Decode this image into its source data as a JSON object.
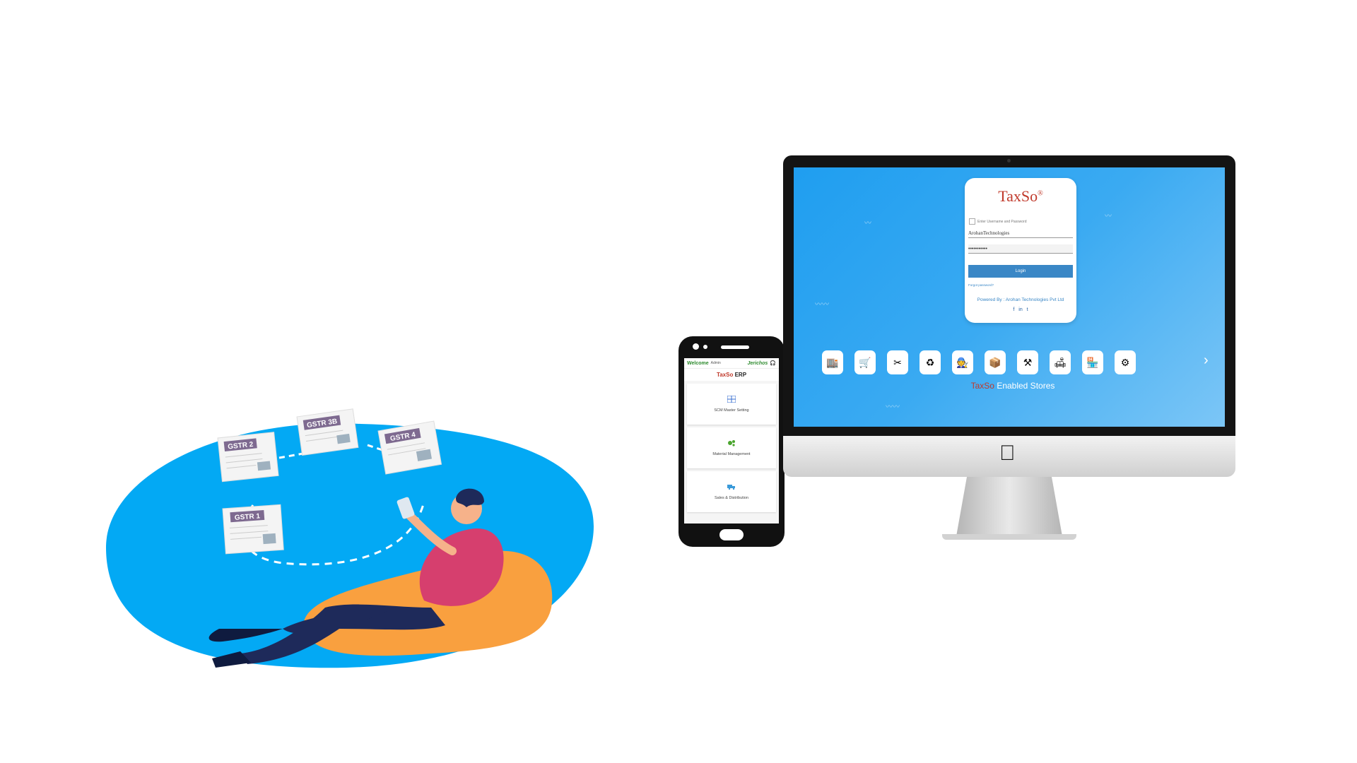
{
  "illustration": {
    "forms": [
      "GSTR 2",
      "GSTR 3B",
      "GSTR 4",
      "GSTR 1"
    ]
  },
  "phone": {
    "welcome": "Welcome",
    "admin": "Admin",
    "brand": "Jerichos",
    "title_brand": "TaxSo",
    "title_suffix": "ERP",
    "cards": [
      {
        "label": "SCM Master Setting",
        "icon": "grid-icon"
      },
      {
        "label": "Material Management",
        "icon": "gears-icon"
      },
      {
        "label": "Sales & Distribution",
        "icon": "truck-icon"
      }
    ]
  },
  "login": {
    "logo": "TaxSo",
    "logo_mark": "®",
    "prompt": "Enter Username and Password",
    "username": "ArohanTechnologies",
    "password": "•••••••••••",
    "login_button": "Login",
    "forgot": "Forgot password?",
    "powered_by": "Powered By : Arohan Technologies Pvt Ltd",
    "social": [
      "f",
      "in",
      "t"
    ]
  },
  "stores": {
    "label_brand": "TaxSo",
    "label_text": "Enabled Stores",
    "icons": [
      "🏬",
      "🛒",
      "✂",
      "♻",
      "🧑‍🔧",
      "📦",
      "⚒",
      "🛋",
      "🏪",
      "⚙"
    ],
    "arrow": "›"
  },
  "colors": {
    "screen_blue": "#1f9ef0",
    "brand_red": "#c0392b",
    "login_blue": "#3a87c6",
    "blob_blue": "#03a9f4",
    "beanbag_orange": "#f9a03f",
    "shirt_pink": "#d63f6e"
  }
}
